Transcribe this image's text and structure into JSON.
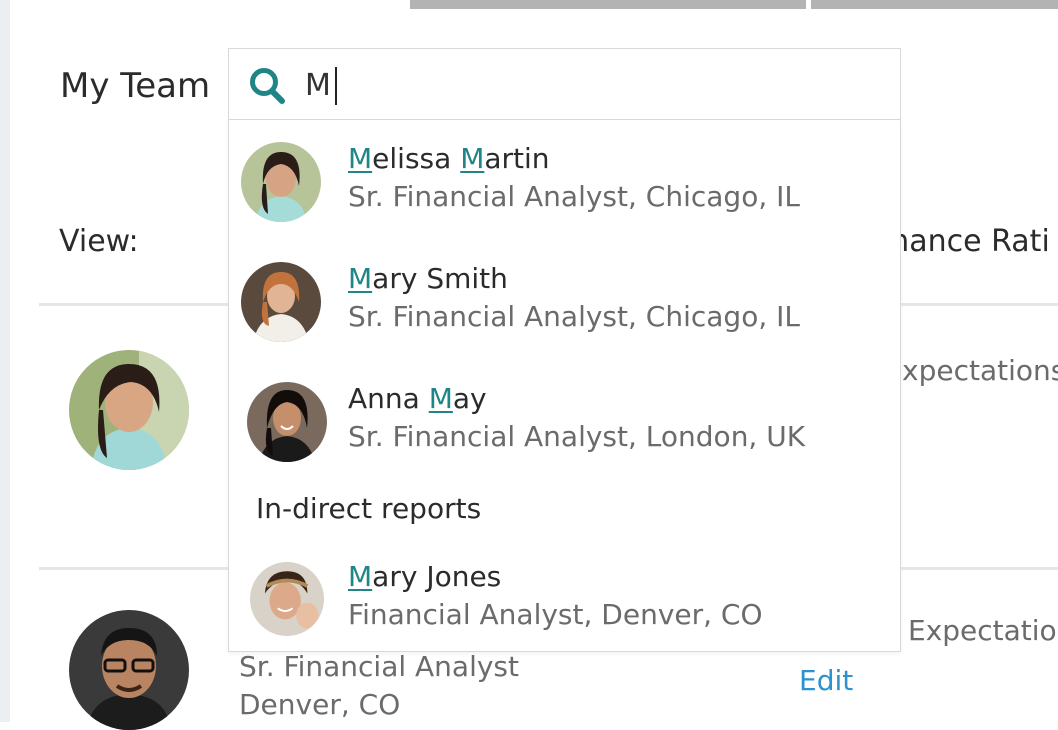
{
  "page": {
    "title": "My Team",
    "view_label": "View:",
    "performance_header": "mance Rati"
  },
  "search": {
    "value": "M",
    "placeholder": ""
  },
  "results": [
    {
      "name_hl_1": "M",
      "name_part_1": "elissa ",
      "name_hl_2": "M",
      "name_part_2": "artin",
      "subtitle": "Sr. Financial Analyst, Chicago, IL"
    },
    {
      "name_hl_1": "M",
      "name_part_1": "ary Smith",
      "subtitle": "Sr. Financial Analyst, Chicago, IL"
    },
    {
      "name_part_0": "Anna ",
      "name_hl_1": "M",
      "name_part_1": "ay",
      "subtitle": "Sr. Financial Analyst, London, UK"
    }
  ],
  "indirect": {
    "label": "In-direct reports",
    "items": [
      {
        "name_hl_1": "M",
        "name_part_1": "ary Jones",
        "subtitle": "Financial Analyst, Denver, CO"
      }
    ]
  },
  "rows": [
    {
      "rating": "xpectations"
    },
    {
      "rating": "Expectations",
      "title": "Sr. Financial Analyst",
      "location": "Denver, CO",
      "edit_label": "Edit"
    }
  ],
  "colors": {
    "accent_teal": "#1f8587",
    "link_blue": "#2a93cf"
  },
  "icons": {
    "search": "search-icon"
  }
}
